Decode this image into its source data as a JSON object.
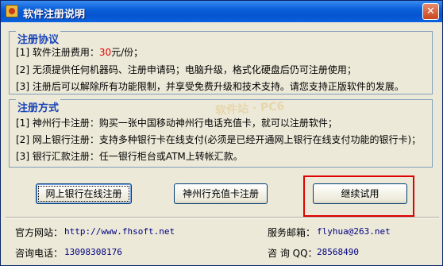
{
  "window": {
    "title": "软件注册说明",
    "close_glyph": "✕"
  },
  "agreement": {
    "heading": "注册协议",
    "line1_prefix": "[1] 软件注册费用：",
    "line1_price": "30",
    "line1_suffix": "元/份；",
    "line2": "[2] 无须提供任何机器码、注册申请码；电脑升级，格式化硬盘后仍可注册使用；",
    "line3": "[3] 注册后可以解除所有功能限制，并享受免费升级和技术支持。请您支持正版软件的发展。"
  },
  "methods": {
    "heading": "注册方式",
    "line1": "[1] 神州行卡注册：购买一张中国移动神州行电话充值卡，就可以注册软件；",
    "line2": "[2] 网上银行注册：支持多种银行卡在线支付(必须是已经开通网上银行在线支付功能的银行卡)；",
    "line3": "[3] 银行汇款注册：任一银行柜台或ATM上转帐汇款。"
  },
  "buttons": {
    "online_bank": "网上银行在线注册",
    "shenzhouxing": "神州行充值卡注册",
    "continue_trial": "继续试用"
  },
  "footer": {
    "website_label": "官方网站：",
    "website_value": "http://www.fhsoft.net",
    "email_label": "服务邮箱：",
    "email_value": "flyhua@263.net",
    "phone_label": "咨询电话：",
    "phone_value": "13098308176",
    "qq_label": "咨 询 QQ：",
    "qq_value": "28568490"
  },
  "colors": {
    "accent": "#1843b8",
    "price": "#e00000",
    "highlight": "#e00000",
    "titlebar": "#0654d0"
  }
}
